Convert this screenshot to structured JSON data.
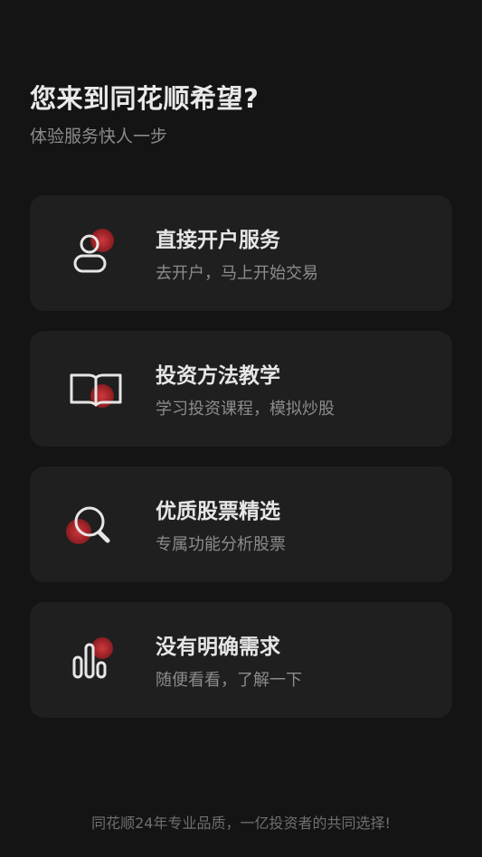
{
  "header": {
    "title": "您来到同花顺希望?",
    "subtitle": "体验服务快人一步"
  },
  "options": [
    {
      "title": "直接开户服务",
      "desc": "去开户，马上开始交易",
      "icon": "user-icon"
    },
    {
      "title": "投资方法教学",
      "desc": "学习投资课程，模拟炒股",
      "icon": "book-icon"
    },
    {
      "title": "优质股票精选",
      "desc": "专属功能分析股票",
      "icon": "search-icon"
    },
    {
      "title": "没有明确需求",
      "desc": "随便看看，了解一下",
      "icon": "bar-chart-icon"
    }
  ],
  "footer": {
    "text": "同花顺24年专业品质，一亿投资者的共同选择!"
  },
  "colors": {
    "background": "#141414",
    "card": "#1f1f1f",
    "accent": "#c0282d"
  }
}
